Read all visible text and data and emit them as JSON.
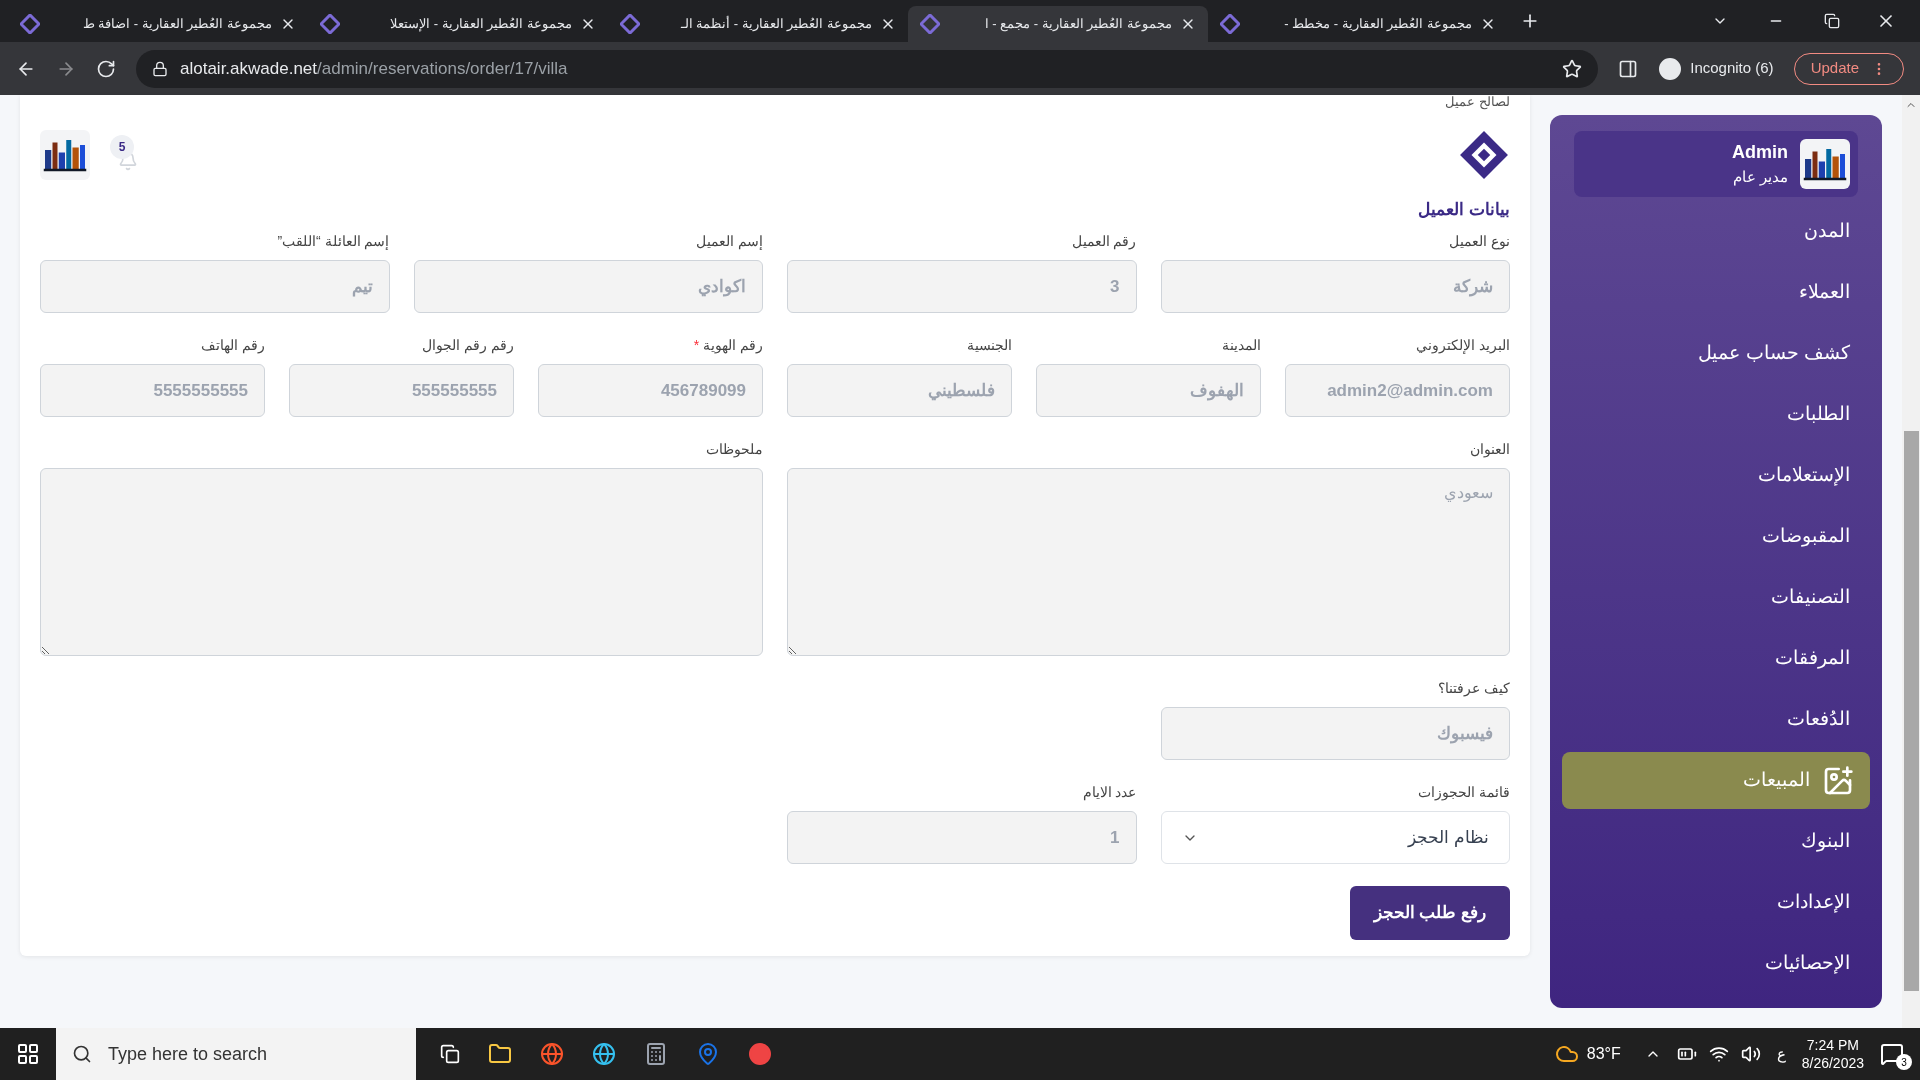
{
  "browser": {
    "tabs": [
      {
        "title": "مجموعة العُطير العقارية - مخطط -",
        "selected": false
      },
      {
        "title": "مجموعة العُطير العقارية - مجمع - ا",
        "selected": true
      },
      {
        "title": "مجموعة العُطير العقارية - أنظمة الـ",
        "selected": false
      },
      {
        "title": "مجموعة العُطير العقارية - الإستعلا",
        "selected": false
      },
      {
        "title": "مجموعة العُطير العقارية - اضافة ط",
        "selected": false
      }
    ],
    "url_host": "alotair.akwade.net",
    "url_path": "/admin/reservations/order/17/villa",
    "incognito": "Incognito (6)",
    "update": "Update"
  },
  "top_caption": "لصالح عميل",
  "header": {
    "notification_count": "5"
  },
  "section_title": "بيانات العميل",
  "form_rows": [
    {
      "fields": [
        {
          "kind": "input",
          "label": "نوع العميل",
          "value": "شركة",
          "disabled": true
        },
        {
          "kind": "input",
          "label": "رقم العميل",
          "value": "3",
          "disabled": true
        },
        {
          "kind": "input",
          "label": "إسم العميل",
          "value": "اكوادي",
          "disabled": true
        },
        {
          "kind": "input",
          "label": "إسم العائلة “اللقب”",
          "value": "تيم",
          "disabled": true
        }
      ]
    },
    {
      "fields": [
        {
          "kind": "input",
          "label": "البريد الإلكتروني",
          "value": "admin2@admin.com",
          "disabled": true
        },
        {
          "kind": "input",
          "label": "المدينة",
          "value": "الهفوف",
          "disabled": true
        },
        {
          "kind": "input",
          "label": "الجنسية",
          "value": "فلسطيني",
          "disabled": true
        },
        {
          "kind": "input",
          "label": "رقم الهوية",
          "required_mark": "*",
          "value": "456789099",
          "disabled": true
        },
        {
          "kind": "input",
          "label": "رقم رقم الجوال",
          "value": "555555555",
          "disabled": true
        },
        {
          "kind": "input",
          "label": "رقم الهاتف",
          "value": "5555555555",
          "disabled": true
        }
      ]
    },
    {
      "fields": [
        {
          "kind": "textarea",
          "label": "العنوان",
          "value": "سعودي",
          "disabled": true
        },
        {
          "kind": "textarea",
          "label": "ملحوظات",
          "disabled": true
        }
      ]
    },
    {
      "fields": [
        {
          "kind": "input",
          "label": "كيف عرفتنا؟",
          "value": "فيسبوك",
          "disabled": true
        }
      ]
    },
    {
      "fields": [
        {
          "kind": "select",
          "label": "قائمة الحجوزات",
          "value": "نظام الحجز",
          "disabled": false
        },
        {
          "kind": "input",
          "label": "عدد الايام",
          "value": "1",
          "disabled": true
        }
      ]
    }
  ],
  "submit_button": "رفع طلب الحجز",
  "sidebar": {
    "user": {
      "name": "Admin",
      "role": "مدير عام"
    },
    "items": [
      {
        "label": "المدن",
        "selected": false
      },
      {
        "label": "العملاء",
        "selected": false
      },
      {
        "label": "كشف حساب عميل",
        "selected": false
      },
      {
        "label": "الطلبات",
        "selected": false
      },
      {
        "label": "الإستعلامات",
        "selected": false
      },
      {
        "label": "المقبوضات",
        "selected": false
      },
      {
        "label": "التصنيفات",
        "selected": false
      },
      {
        "label": "المرفقات",
        "selected": false
      },
      {
        "label": "الدُفعات",
        "selected": false
      },
      {
        "label": "المبيعات",
        "selected": true
      },
      {
        "label": "البنوك",
        "selected": false
      },
      {
        "label": "الإعدادات",
        "selected": false
      },
      {
        "label": "الإحصائيات",
        "selected": false
      }
    ]
  },
  "taskbar": {
    "search_placeholder": "Type here to search",
    "weather": "83°F",
    "language": "ع",
    "time": "7:24 PM",
    "date": "8/26/2023",
    "notifications": "3"
  }
}
